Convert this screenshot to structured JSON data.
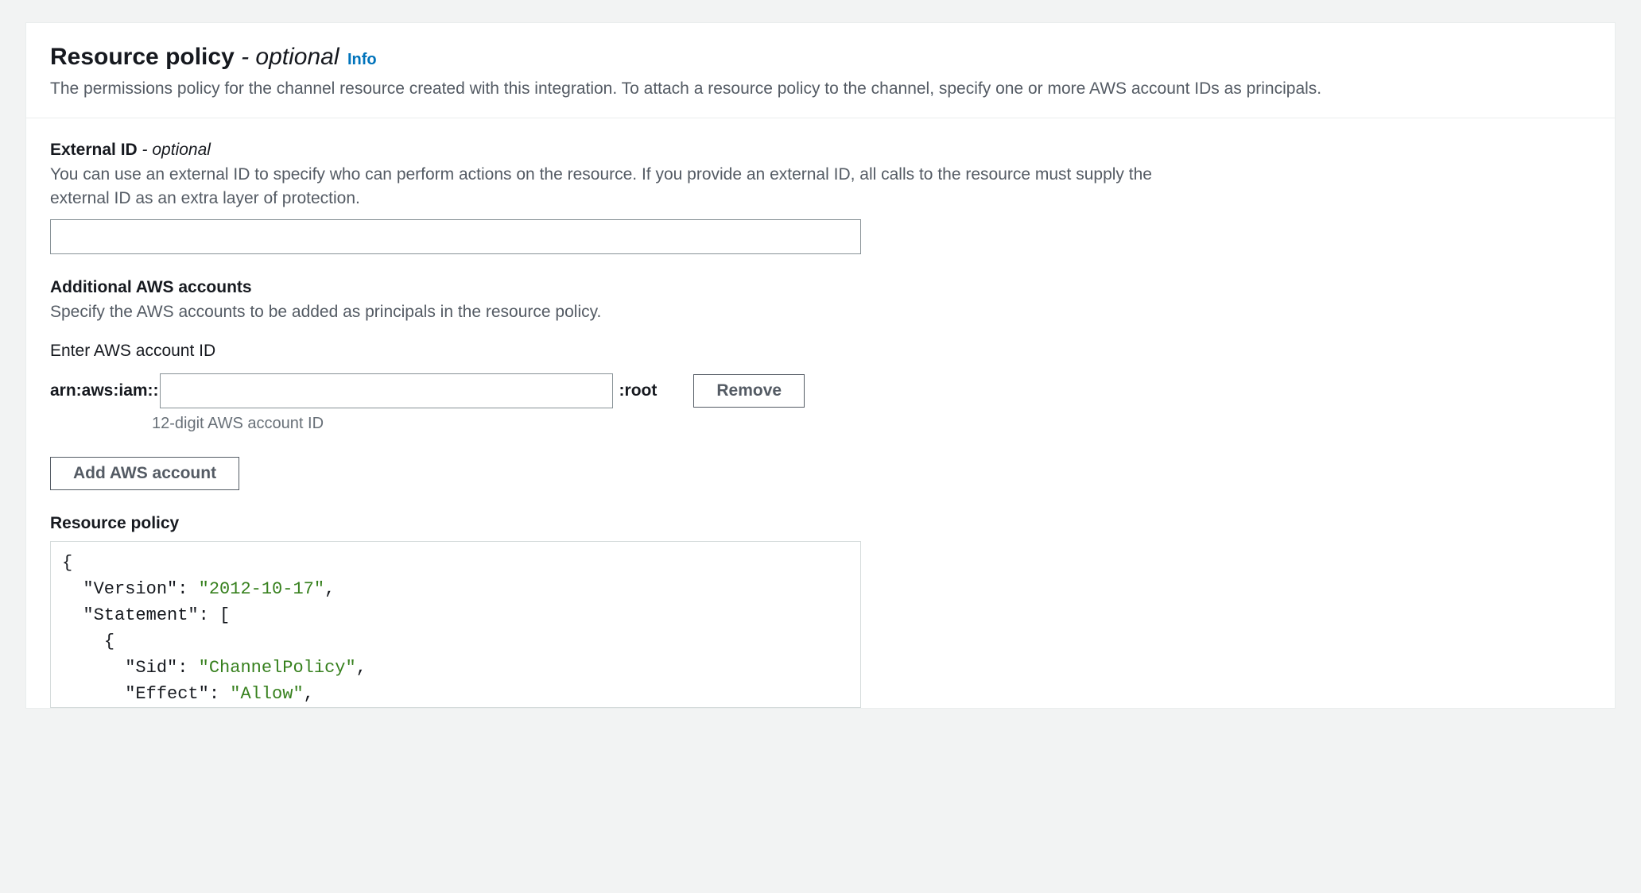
{
  "header": {
    "title": "Resource policy",
    "optional": " - optional",
    "info": "Info",
    "description": "The permissions policy for the channel resource created with this integration. To attach a resource policy to the channel, specify one or more AWS account IDs as principals."
  },
  "externalId": {
    "label": "External ID",
    "optional": " - optional",
    "description": "You can use an external ID to specify who can perform actions on the resource. If you provide an external ID, all calls to the resource must supply the external ID as an extra layer of protection.",
    "value": ""
  },
  "accounts": {
    "label": "Additional AWS accounts",
    "description": "Specify the AWS accounts to be added as principals in the resource policy.",
    "enterLabel": "Enter AWS account ID",
    "arnPrefix": "arn:aws:iam::",
    "arnSuffix": ":root",
    "value": "",
    "hint": "12-digit AWS account ID",
    "removeLabel": "Remove",
    "addLabel": "Add AWS account"
  },
  "policy": {
    "label": "Resource policy",
    "json": {
      "Version": "2012-10-17",
      "Statement": [
        {
          "Sid": "ChannelPolicy",
          "Effect": "Allow"
        }
      ]
    }
  }
}
